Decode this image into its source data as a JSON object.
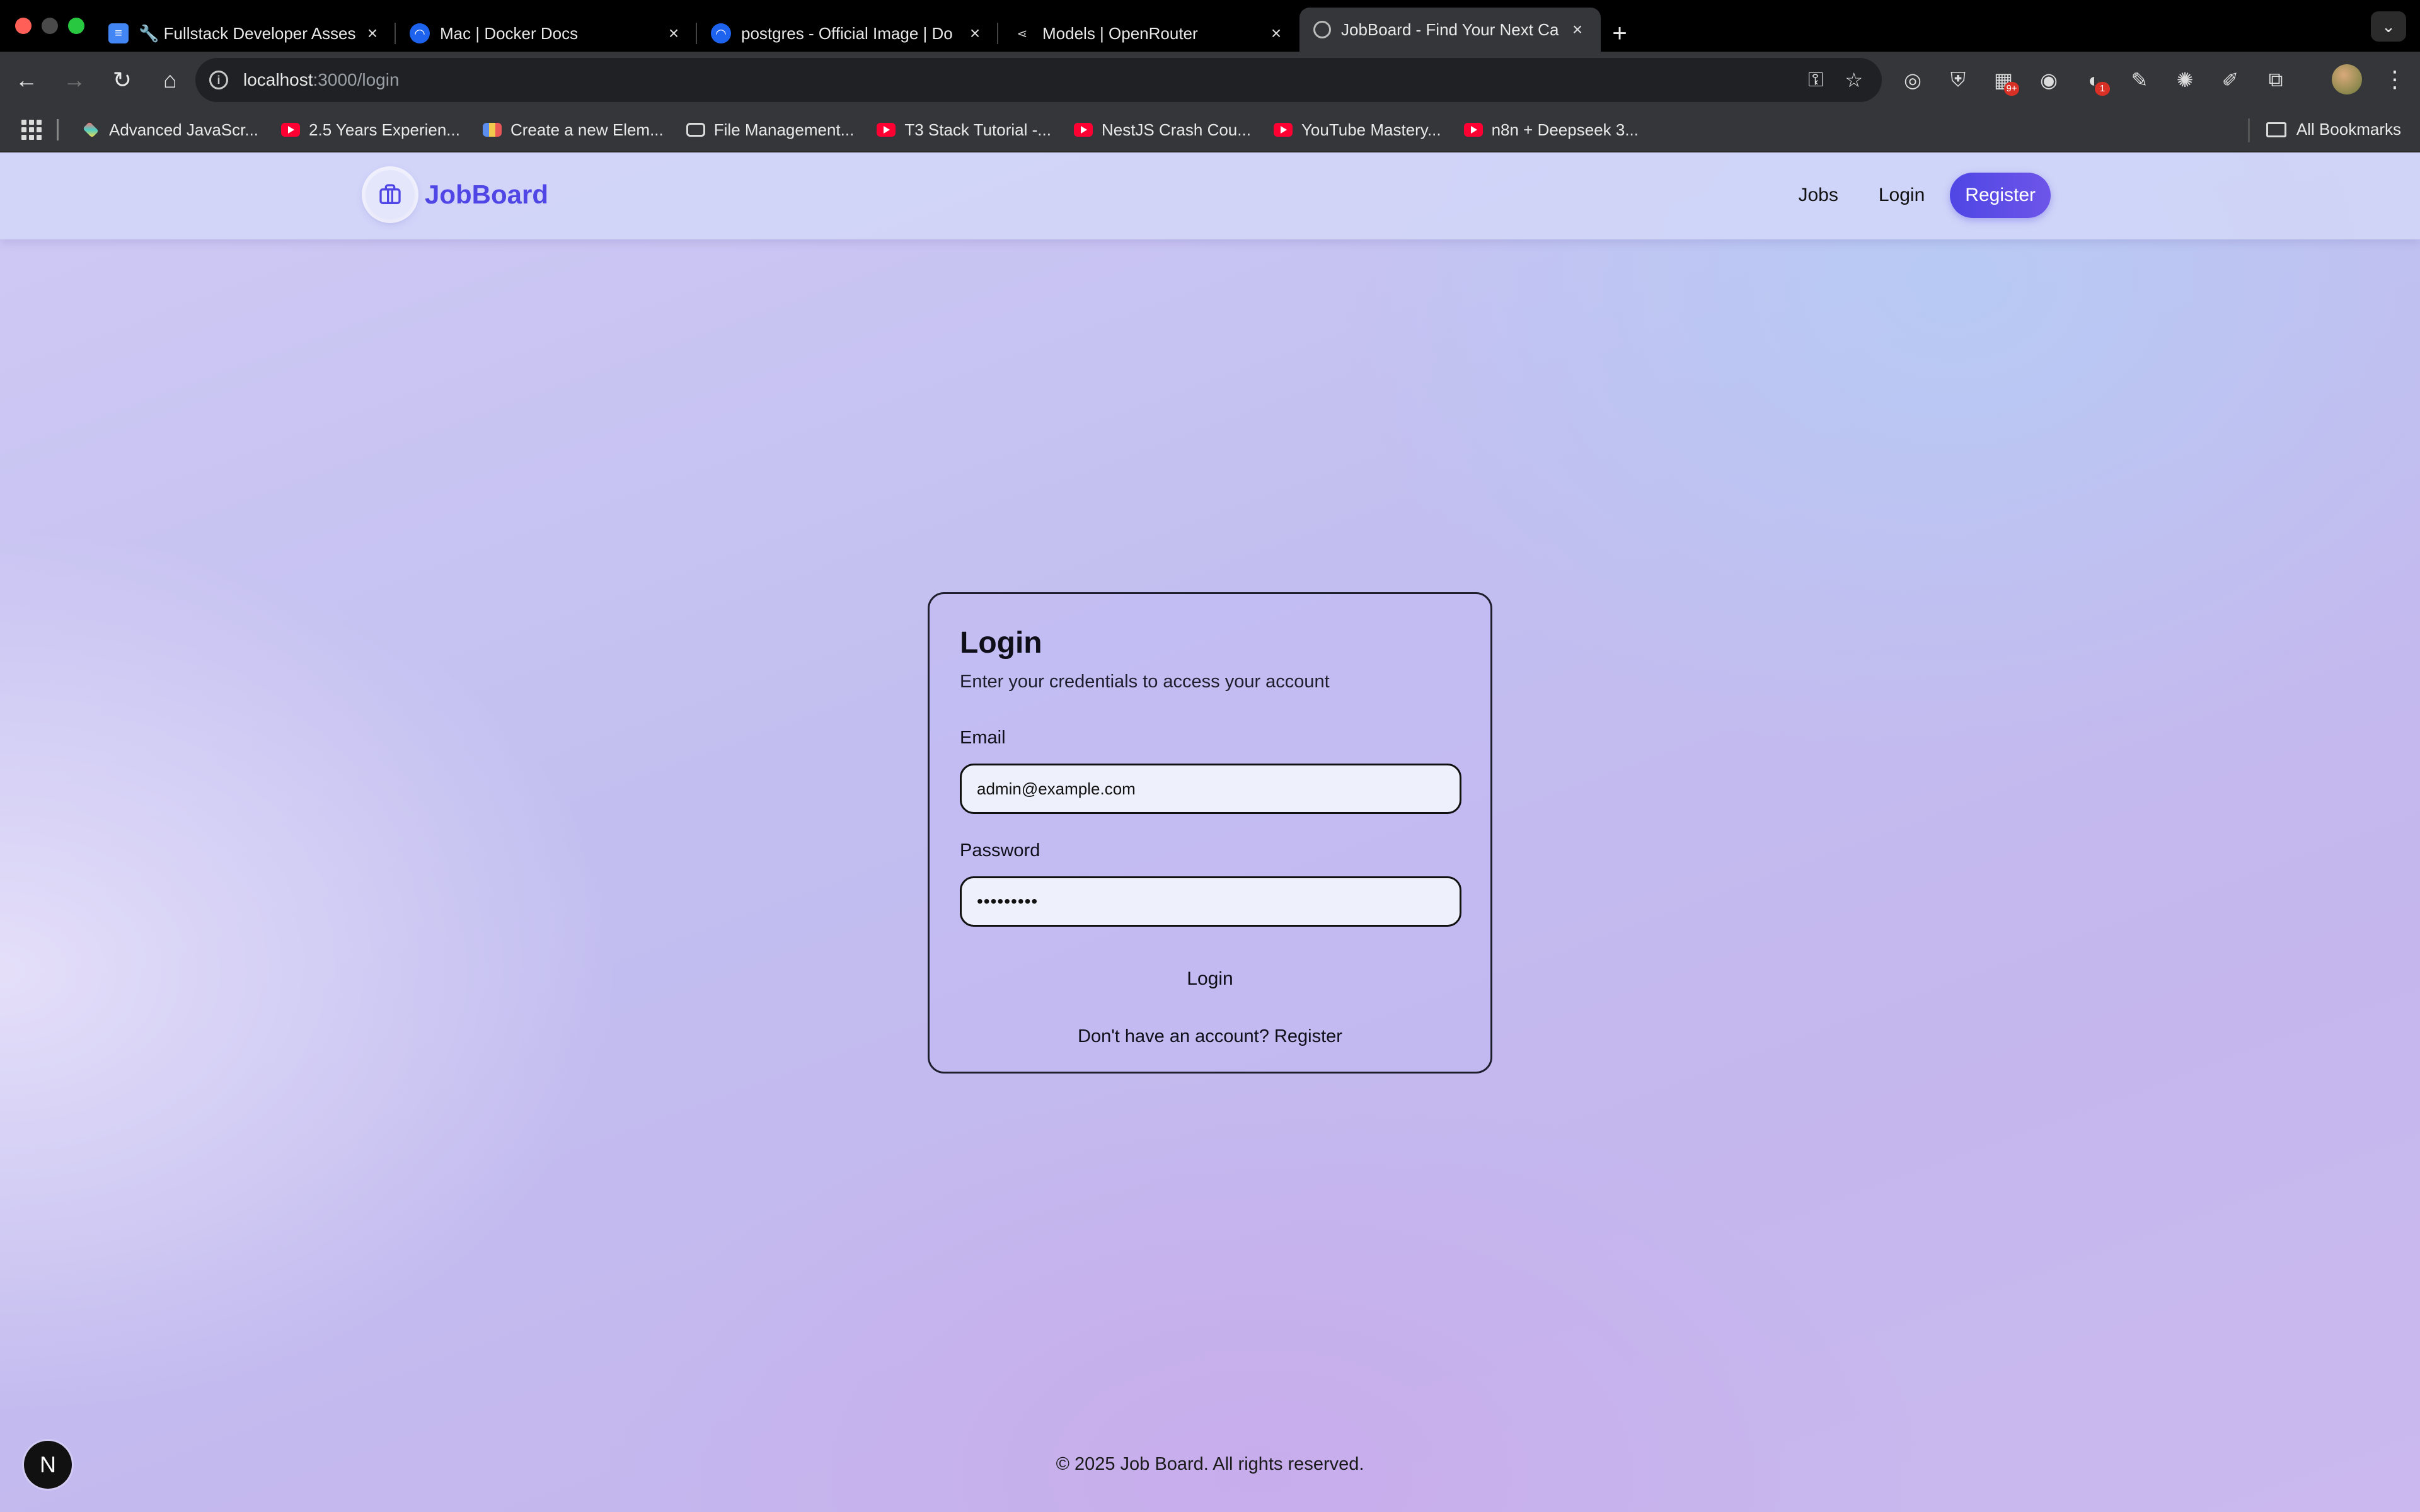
{
  "browser": {
    "tabs": [
      {
        "title": "🔧 Fullstack Developer Asses",
        "icon": "google-docs-icon",
        "active": false
      },
      {
        "title": "Mac | Docker Docs",
        "icon": "docker-icon",
        "active": false
      },
      {
        "title": "postgres - Official Image | Do",
        "icon": "docker-icon",
        "active": false
      },
      {
        "title": "Models | OpenRouter",
        "icon": "openrouter-icon",
        "active": false
      },
      {
        "title": "JobBoard - Find Your Next Ca",
        "icon": "globe-icon",
        "active": true
      }
    ],
    "url_host": "localhost",
    "url_path": ":3000/login",
    "bookmarks": [
      {
        "label": "Advanced JavaScr...",
        "icon": "layers-icon"
      },
      {
        "label": "2.5 Years Experien...",
        "icon": "youtube-icon"
      },
      {
        "label": "Create a new Elem...",
        "icon": "multicolor-icon"
      },
      {
        "label": "File Management...",
        "icon": "globe-icon"
      },
      {
        "label": "T3 Stack Tutorial -...",
        "icon": "youtube-icon"
      },
      {
        "label": "NestJS Crash Cou...",
        "icon": "youtube-icon"
      },
      {
        "label": "YouTube Mastery...",
        "icon": "youtube-icon"
      },
      {
        "label": "n8n + Deepseek 3...",
        "icon": "youtube-icon"
      }
    ],
    "all_bookmarks_label": "All Bookmarks",
    "extension_badges": {
      "ext3": "9+",
      "ext5": "1"
    }
  },
  "site": {
    "brand": "JobBoard",
    "nav": {
      "jobs": "Jobs",
      "login": "Login",
      "register": "Register"
    },
    "colors": {
      "accent": "#4f46e5"
    }
  },
  "login_card": {
    "title": "Login",
    "subtitle": "Enter your credentials to access your account",
    "email_label": "Email",
    "email_value": "admin@example.com",
    "password_label": "Password",
    "password_value": "•••••••••",
    "submit_label": "Login",
    "footer_text": "Don't have an account? Register"
  },
  "footer": {
    "text": "© 2025 Job Board. All rights reserved."
  },
  "dev_badge": {
    "label": "N"
  }
}
